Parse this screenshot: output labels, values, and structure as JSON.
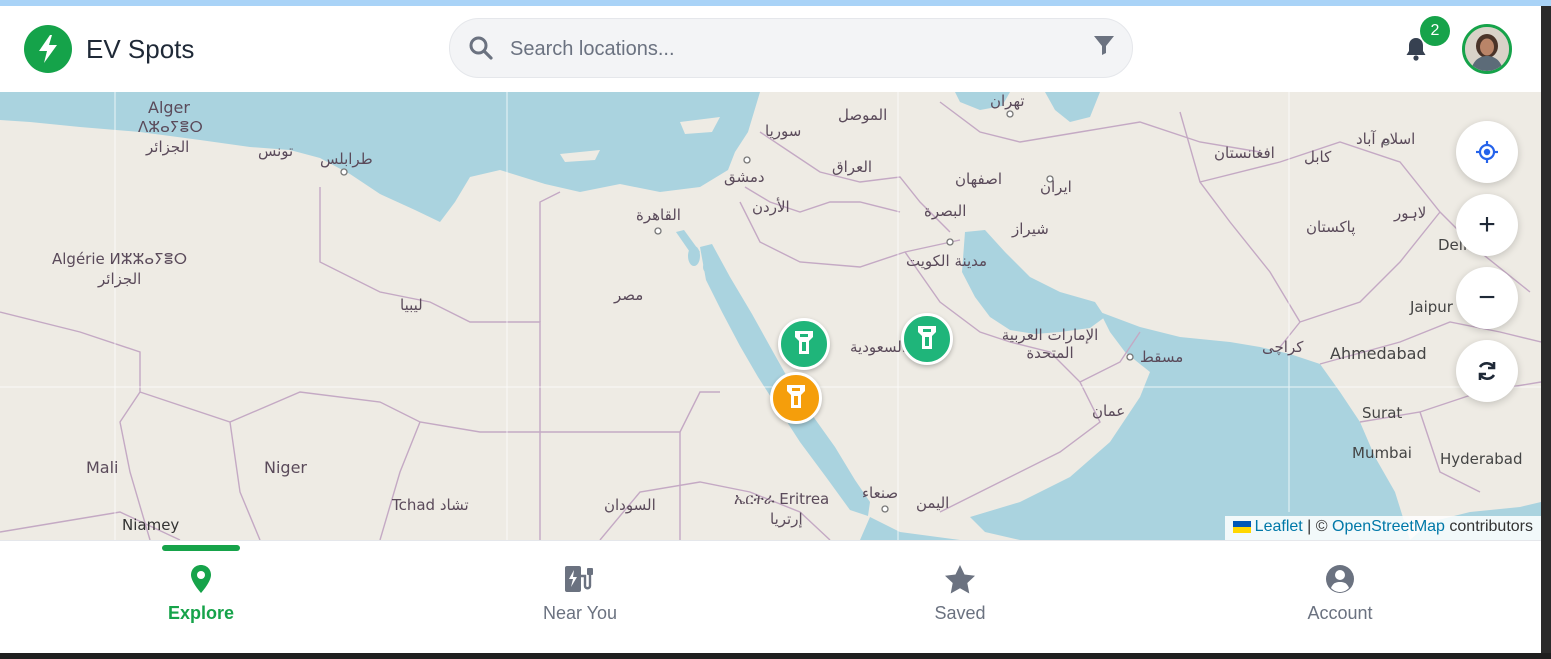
{
  "app": {
    "title": "EV Spots",
    "brand_color": "#16a34a"
  },
  "search": {
    "placeholder": "Search locations..."
  },
  "notifications": {
    "count": "2"
  },
  "map": {
    "labels": {
      "alger": "Alger",
      "alger_tifinagh": "ⴷⵣⴰⵢⴻⵔ",
      "aljazair": "الجزائر",
      "tunis": "تونس",
      "tarabulus": "طرابلس",
      "syria": "سوريا",
      "mosul": "الموصل",
      "tehran": "تهران",
      "iraq": "العراق",
      "damascus": "دمشق",
      "jordan": "الأردن",
      "isfahan": "اصفهان",
      "iran": "ایران",
      "cairo": "القاهرة",
      "basra": "البصرة",
      "shiraz": "شیراز",
      "kuwait": "مدينة الكويت",
      "algerie": "Algérie ⵍⵣⵣⴰⵢⴻⵔ",
      "aljazair2": "الجزائر",
      "egypt": "مصر",
      "libya": "ليبيا",
      "saudi": "السعودية",
      "uae": "الإمارات العربية المتحدة",
      "muscat": "مسقط",
      "karachi": "کراچی",
      "ahmedabad": "Ahmedabad",
      "oman": "عمان",
      "surat": "Surat",
      "mumbai": "Mumbai",
      "hyderabad": "Hyderabad",
      "mali": "Mali",
      "niger": "Niger",
      "tchad": "Tchad تشاد",
      "sudan": "السودان",
      "eritrea": "ኤርትራ Eritrea",
      "eritrea_ar": "إرتريا",
      "sanaa": "صنعاء",
      "yemen": "اليمن",
      "niamey": "Niamey",
      "afghanistan": "افغانستان",
      "kabul": "کابل",
      "islamabad": "اسلام آباد",
      "pakistan": "پاکستان",
      "lahore": "لاہور",
      "delhi": "Delhi",
      "jaipur": "Jaipur"
    },
    "markers": [
      {
        "name": "station-marker-1",
        "status": "available",
        "color": "#1fb57a"
      },
      {
        "name": "station-marker-2",
        "status": "available",
        "color": "#1fb57a"
      },
      {
        "name": "station-marker-3",
        "status": "busy",
        "color": "#f59e0b"
      }
    ],
    "controls": {
      "zoom_in": "+",
      "zoom_out": "−"
    },
    "attribution": {
      "leaflet": "Leaflet",
      "sep": " | © ",
      "osm": "OpenStreetMap",
      "suffix": " contributors"
    }
  },
  "nav": {
    "items": [
      {
        "label": "Explore",
        "icon": "map-pin-icon",
        "active": true
      },
      {
        "label": "Near You",
        "icon": "ev-charger-icon",
        "active": false
      },
      {
        "label": "Saved",
        "icon": "star-icon",
        "active": false
      },
      {
        "label": "Account",
        "icon": "user-circle-icon",
        "active": false
      }
    ]
  }
}
